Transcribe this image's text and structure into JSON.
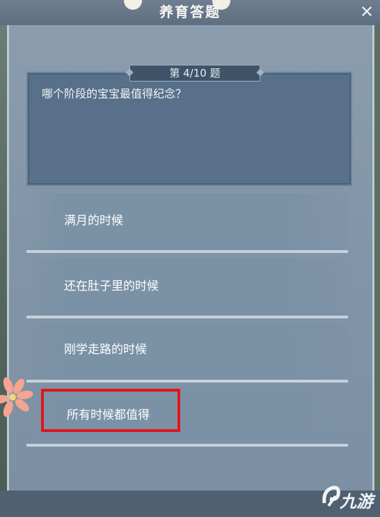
{
  "header": {
    "title": "养育答题",
    "close_icon": "close-icon"
  },
  "question": {
    "number_label": "第 4/10 题",
    "text": "哪个阶段的宝宝最值得纪念？"
  },
  "options": [
    {
      "label": "满月的时候"
    },
    {
      "label": "还在肚子里的时候"
    },
    {
      "label": "刚学走路的时候"
    },
    {
      "label": "所有时候都值得"
    }
  ],
  "highlight": {
    "color": "#e3141b",
    "option_index": 3
  },
  "watermark": {
    "text": "九游",
    "icon": "jiuyou-logo-icon"
  },
  "colors": {
    "panel": "#8295a8",
    "question_box": "#587089",
    "option_bg": "#7b91a6"
  }
}
